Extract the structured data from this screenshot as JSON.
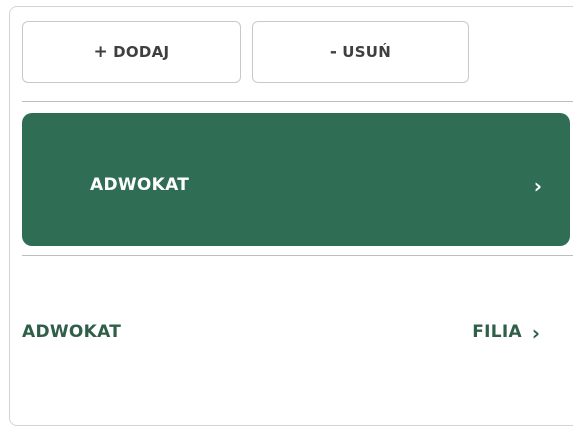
{
  "toolbar": {
    "add": {
      "glyph": "+",
      "label": "DODAJ"
    },
    "remove": {
      "glyph": "-",
      "label": "USUŃ"
    }
  },
  "list": {
    "items": [
      {
        "title": "ADWOKAT",
        "subtitle": "",
        "chevron": "›",
        "selected": true
      },
      {
        "title": "ADWOKAT",
        "subtitle": "FILIA",
        "chevron": "›",
        "selected": false
      }
    ]
  },
  "colors": {
    "selected_bg": "#2f6d55",
    "selected_text": "#ffffff",
    "item_text": "#2f5f49",
    "button_text": "#3f3f3f",
    "border": "#c9c9c9"
  }
}
